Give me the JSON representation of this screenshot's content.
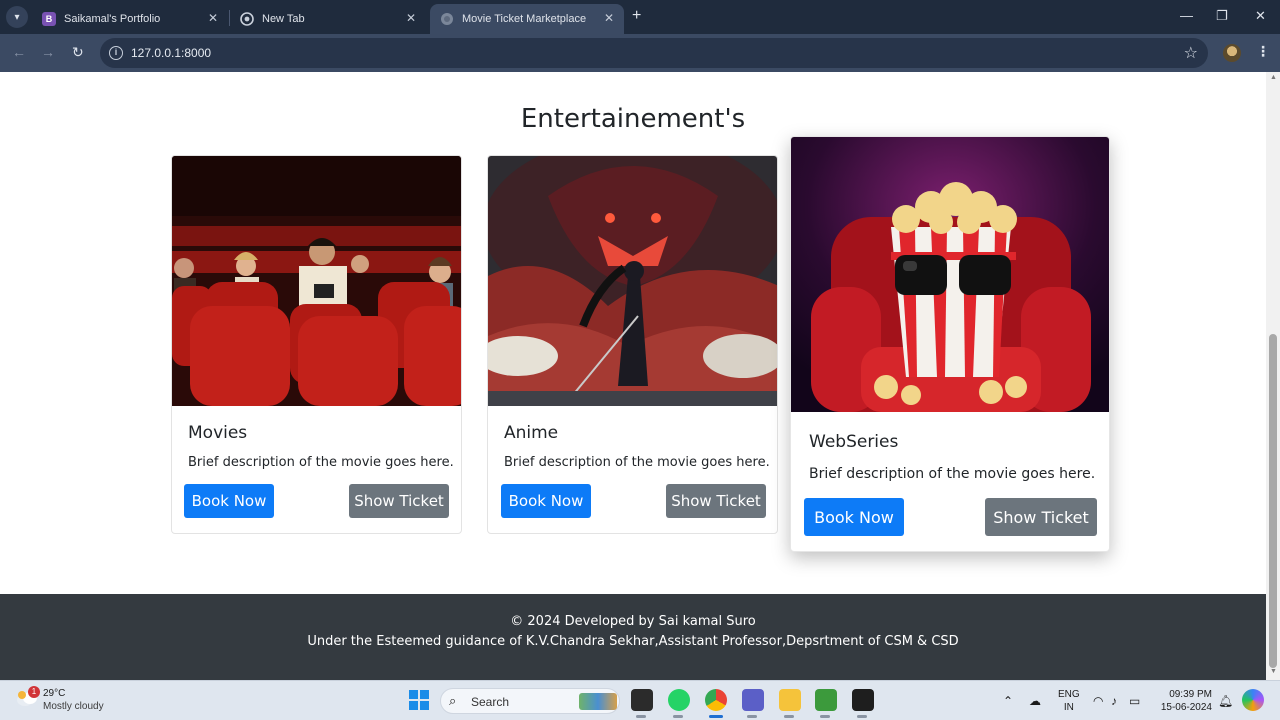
{
  "browser": {
    "tabs": [
      {
        "title": "Saikamal's Portfolio",
        "favicon": "B",
        "favicon_color": "#7952b3",
        "active": false
      },
      {
        "title": "New Tab",
        "favicon": "chrome",
        "favicon_color": "#9aa4b5",
        "active": false
      },
      {
        "title": "Movie Ticket Marketplace",
        "favicon": "globe",
        "favicon_color": "#9aa4b5",
        "active": true
      }
    ],
    "new_tab": "+",
    "url": "127.0.0.1:8000",
    "icons": {
      "back": "←",
      "forward": "→",
      "reload": "↻",
      "star": "☆",
      "minimize": "—",
      "maximize": "❐",
      "close": "✕",
      "menu": "⋮",
      "tab_list": "▾",
      "tab_close": "✕",
      "info": "i"
    }
  },
  "page": {
    "title": "Entertainement's",
    "cards": [
      {
        "title": "Movies",
        "description": "Brief description of the movie goes here.",
        "book_label": "Book Now",
        "show_label": "Show Ticket",
        "image": "cinema-audience"
      },
      {
        "title": "Anime",
        "description": "Brief description of the movie goes here.",
        "book_label": "Book Now",
        "show_label": "Show Ticket",
        "image": "anime-dragon-warrior"
      },
      {
        "title": "WebSeries",
        "description": "Brief description of the movie goes here.",
        "book_label": "Book Now",
        "show_label": "Show Ticket",
        "image": "popcorn-sunglasses"
      }
    ],
    "footer": {
      "line1": "© 2024 Developed by Sai kamal Suro",
      "line2": "Under the Esteemed guidance of K.V.Chandra Sekhar,Assistant Professor,Depsrtment of CSM & CSD"
    },
    "colors": {
      "primary": "#0d7bf7",
      "secondary": "#6c757d",
      "footer_bg": "#343a40"
    }
  },
  "taskbar": {
    "weather": {
      "temp": "29°C",
      "desc": "Mostly cloudy",
      "badge": "1"
    },
    "search_placeholder": "Search",
    "lang_line1": "ENG",
    "lang_line2": "IN",
    "time": "09:39 PM",
    "date": "15-06-2024"
  }
}
